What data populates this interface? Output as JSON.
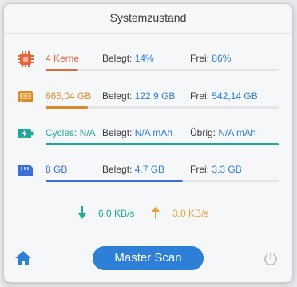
{
  "title": "Systemzustand",
  "rows": [
    {
      "name": "cpu",
      "icon": "cpu-chip-icon",
      "color": "#e8643c",
      "primary": "4 Kerne",
      "used_key": "Belegt: ",
      "used_val": "14%",
      "free_key": "Frei: ",
      "free_val": "86%",
      "fill_percent": 14
    },
    {
      "name": "disk",
      "icon": "hard-drive-icon",
      "color": "#d98a2b",
      "primary": "665,04 GB",
      "used_key": "Belegt: ",
      "used_val": "122,9 GB",
      "free_key": "Frei: ",
      "free_val": "542,14 GB",
      "fill_percent": 18
    },
    {
      "name": "battery",
      "icon": "battery-charging-icon",
      "color": "#20a89a",
      "primary": "Cycles: N/A",
      "used_key": "Belegt: ",
      "used_val": "N/A mAh",
      "free_key": "Übrig: ",
      "free_val": "N/A mAh",
      "fill_percent": 100
    },
    {
      "name": "memory",
      "icon": "memory-card-icon",
      "color": "#3b6fd4",
      "primary": "8 GB",
      "used_key": "Belegt: ",
      "used_val": "4.7 GB",
      "free_key": "Frei: ",
      "free_val": "3.3 GB",
      "fill_percent": 59
    }
  ],
  "network": {
    "download": "6.0 KB/s",
    "upload": "3.0 KB/s",
    "download_color": "#20a89a",
    "upload_color": "#e8a23a"
  },
  "footer": {
    "scan_label": "Master Scan",
    "home_icon": "home-icon",
    "power_icon": "power-icon"
  },
  "colors": {
    "value_blue": "#2d7fd8",
    "button_blue": "#2d7fd8"
  }
}
